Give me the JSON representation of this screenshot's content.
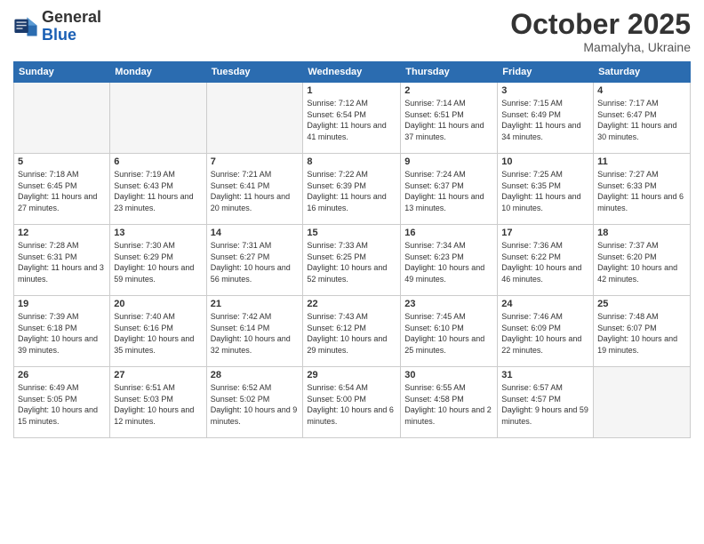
{
  "logo": {
    "line1": "General",
    "line2": "Blue"
  },
  "title": "October 2025",
  "location": "Mamalyha, Ukraine",
  "days_of_week": [
    "Sunday",
    "Monday",
    "Tuesday",
    "Wednesday",
    "Thursday",
    "Friday",
    "Saturday"
  ],
  "weeks": [
    [
      {
        "day": "",
        "info": ""
      },
      {
        "day": "",
        "info": ""
      },
      {
        "day": "",
        "info": ""
      },
      {
        "day": "1",
        "info": "Sunrise: 7:12 AM\nSunset: 6:54 PM\nDaylight: 11 hours and 41 minutes."
      },
      {
        "day": "2",
        "info": "Sunrise: 7:14 AM\nSunset: 6:51 PM\nDaylight: 11 hours and 37 minutes."
      },
      {
        "day": "3",
        "info": "Sunrise: 7:15 AM\nSunset: 6:49 PM\nDaylight: 11 hours and 34 minutes."
      },
      {
        "day": "4",
        "info": "Sunrise: 7:17 AM\nSunset: 6:47 PM\nDaylight: 11 hours and 30 minutes."
      }
    ],
    [
      {
        "day": "5",
        "info": "Sunrise: 7:18 AM\nSunset: 6:45 PM\nDaylight: 11 hours and 27 minutes."
      },
      {
        "day": "6",
        "info": "Sunrise: 7:19 AM\nSunset: 6:43 PM\nDaylight: 11 hours and 23 minutes."
      },
      {
        "day": "7",
        "info": "Sunrise: 7:21 AM\nSunset: 6:41 PM\nDaylight: 11 hours and 20 minutes."
      },
      {
        "day": "8",
        "info": "Sunrise: 7:22 AM\nSunset: 6:39 PM\nDaylight: 11 hours and 16 minutes."
      },
      {
        "day": "9",
        "info": "Sunrise: 7:24 AM\nSunset: 6:37 PM\nDaylight: 11 hours and 13 minutes."
      },
      {
        "day": "10",
        "info": "Sunrise: 7:25 AM\nSunset: 6:35 PM\nDaylight: 11 hours and 10 minutes."
      },
      {
        "day": "11",
        "info": "Sunrise: 7:27 AM\nSunset: 6:33 PM\nDaylight: 11 hours and 6 minutes."
      }
    ],
    [
      {
        "day": "12",
        "info": "Sunrise: 7:28 AM\nSunset: 6:31 PM\nDaylight: 11 hours and 3 minutes."
      },
      {
        "day": "13",
        "info": "Sunrise: 7:30 AM\nSunset: 6:29 PM\nDaylight: 10 hours and 59 minutes."
      },
      {
        "day": "14",
        "info": "Sunrise: 7:31 AM\nSunset: 6:27 PM\nDaylight: 10 hours and 56 minutes."
      },
      {
        "day": "15",
        "info": "Sunrise: 7:33 AM\nSunset: 6:25 PM\nDaylight: 10 hours and 52 minutes."
      },
      {
        "day": "16",
        "info": "Sunrise: 7:34 AM\nSunset: 6:23 PM\nDaylight: 10 hours and 49 minutes."
      },
      {
        "day": "17",
        "info": "Sunrise: 7:36 AM\nSunset: 6:22 PM\nDaylight: 10 hours and 46 minutes."
      },
      {
        "day": "18",
        "info": "Sunrise: 7:37 AM\nSunset: 6:20 PM\nDaylight: 10 hours and 42 minutes."
      }
    ],
    [
      {
        "day": "19",
        "info": "Sunrise: 7:39 AM\nSunset: 6:18 PM\nDaylight: 10 hours and 39 minutes."
      },
      {
        "day": "20",
        "info": "Sunrise: 7:40 AM\nSunset: 6:16 PM\nDaylight: 10 hours and 35 minutes."
      },
      {
        "day": "21",
        "info": "Sunrise: 7:42 AM\nSunset: 6:14 PM\nDaylight: 10 hours and 32 minutes."
      },
      {
        "day": "22",
        "info": "Sunrise: 7:43 AM\nSunset: 6:12 PM\nDaylight: 10 hours and 29 minutes."
      },
      {
        "day": "23",
        "info": "Sunrise: 7:45 AM\nSunset: 6:10 PM\nDaylight: 10 hours and 25 minutes."
      },
      {
        "day": "24",
        "info": "Sunrise: 7:46 AM\nSunset: 6:09 PM\nDaylight: 10 hours and 22 minutes."
      },
      {
        "day": "25",
        "info": "Sunrise: 7:48 AM\nSunset: 6:07 PM\nDaylight: 10 hours and 19 minutes."
      }
    ],
    [
      {
        "day": "26",
        "info": "Sunrise: 6:49 AM\nSunset: 5:05 PM\nDaylight: 10 hours and 15 minutes."
      },
      {
        "day": "27",
        "info": "Sunrise: 6:51 AM\nSunset: 5:03 PM\nDaylight: 10 hours and 12 minutes."
      },
      {
        "day": "28",
        "info": "Sunrise: 6:52 AM\nSunset: 5:02 PM\nDaylight: 10 hours and 9 minutes."
      },
      {
        "day": "29",
        "info": "Sunrise: 6:54 AM\nSunset: 5:00 PM\nDaylight: 10 hours and 6 minutes."
      },
      {
        "day": "30",
        "info": "Sunrise: 6:55 AM\nSunset: 4:58 PM\nDaylight: 10 hours and 2 minutes."
      },
      {
        "day": "31",
        "info": "Sunrise: 6:57 AM\nSunset: 4:57 PM\nDaylight: 9 hours and 59 minutes."
      },
      {
        "day": "",
        "info": ""
      }
    ]
  ]
}
